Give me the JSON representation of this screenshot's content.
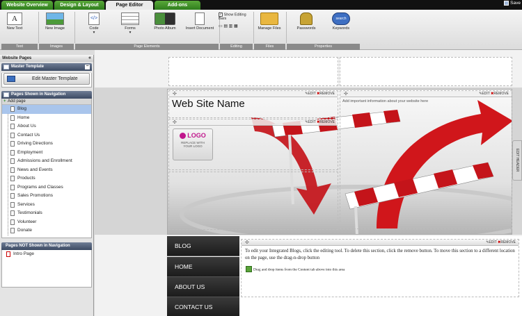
{
  "tabs": [
    "Website Overview",
    "Design & Layout",
    "Page Editor",
    "Add-ons"
  ],
  "active_tab": "Page Editor",
  "save_label": "Save",
  "ribbon": {
    "buttons": {
      "new_text": "New Text",
      "new_image": "New Image",
      "code": "Code",
      "forms": "Forms",
      "photo_album": "Photo Album",
      "insert_document": "Insert Document",
      "show_editing_bars": "Show Editing Bars",
      "manage_files": "Manage Files",
      "passwords": "Passwords",
      "keywords": "Keywords",
      "search_badge": "search"
    },
    "groups": [
      "Text",
      "Images",
      "Page Elements",
      "Editing",
      "Files",
      "Properties"
    ]
  },
  "sidebar": {
    "title": "Website Pages",
    "master_panel_title": "Master Template",
    "edit_master_label": "Edit Master Template",
    "nav_panel_title": "Pages Shown in Navigation",
    "add_page_label": "Add page",
    "nav_pages": [
      "Blog",
      "Home",
      "About Us",
      "Contact Us",
      "Driving Directions",
      "Employment",
      "Admissions and Enrollment",
      "News and Events",
      "Products",
      "Programs and Classes",
      "Sales Promotions",
      "Services",
      "Testimonials",
      "Volunteer",
      "Donate"
    ],
    "selected_page": "Blog",
    "hidden_panel_title": "Pages NOT Shown in Navigation",
    "hidden_pages": [
      "Intro Page"
    ]
  },
  "canvas": {
    "site_name": "Web Site Name",
    "info_text": "Add important information about your website here",
    "logo_text": "LOGO",
    "logo_caption": "REPLACE WITH YOUR LOGO",
    "edit_label": "EDIT",
    "remove_label": "REMOVE",
    "edit_header_label": "EDIT HEADER",
    "nav_buttons": [
      "BLOG",
      "HOME",
      "ABOUT US",
      "CONTACT US"
    ],
    "blog_text": "To edit your Integrated Blogs, click the editing tool. To delete this section, click the remove button. To move this section to a different location on the page, use the drag-n-drop button",
    "drop_text": "Drag and drop items from the Content tab above into this area"
  },
  "colors": {
    "tab_green": "#3d8f27",
    "nav_dark": "#2a2a2a",
    "arrow_red": "#d0161b",
    "selected": "#a9c5ec"
  }
}
